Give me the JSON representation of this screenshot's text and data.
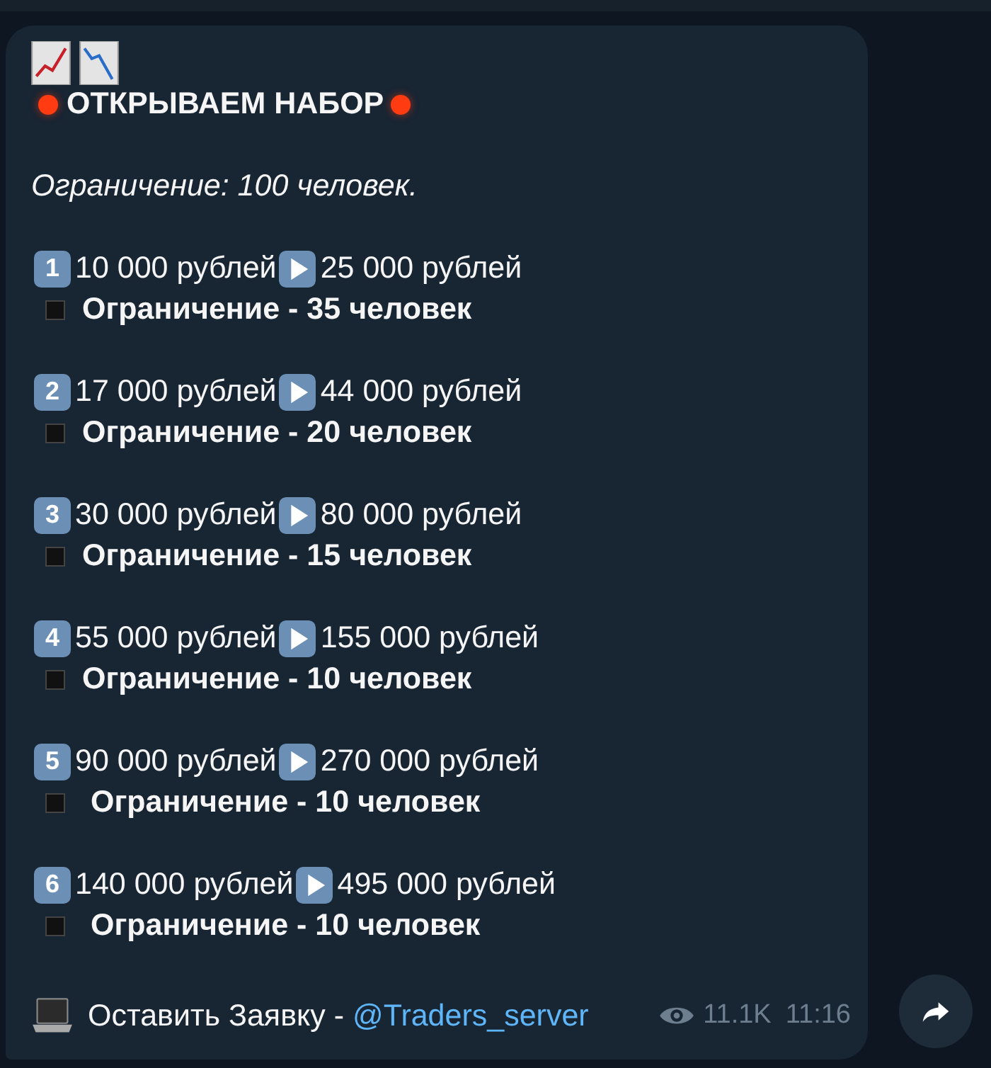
{
  "message": {
    "headline": "ОТКРЫВАЕМ НАБОР",
    "subtitle": "Ограничение: 100 человек.",
    "tiers": [
      {
        "number": "1",
        "from": "10 000 рублей",
        "to": "25 000 рублей",
        "limit": "Ограничение - 35 человек"
      },
      {
        "number": "2",
        "from": "17 000 рублей",
        "to": "44 000 рублей",
        "limit": "Ограничение - 20 человек"
      },
      {
        "number": "3",
        "from": "30 000 рублей",
        "to": "80 000 рублей",
        "limit": "Ограничение - 15 человек"
      },
      {
        "number": "4",
        "from": "55 000 рублей",
        "to": "155 000 рублей",
        "limit": "Ограничение - 10 человек"
      },
      {
        "number": "5",
        "from": "90 000 рублей",
        "to": "270 000 рублей",
        "limit": "Ограничение - 10 человек"
      },
      {
        "number": "6",
        "from": "140 000 рублей",
        "to": "495 000 рублей",
        "limit": "Ограничение - 10 человек"
      }
    ],
    "footer_text": "Оставить Заявку -",
    "link": "@Traders_server",
    "views": "11.1K",
    "time": "11:16"
  }
}
